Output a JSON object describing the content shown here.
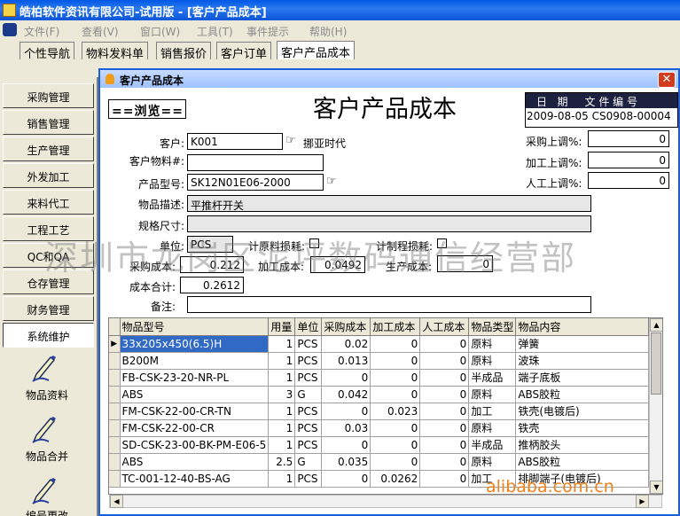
{
  "app": {
    "title": "皓柏软件资讯有限公司-试用版 - [客户产品成本]"
  },
  "menu": [
    {
      "label": "文件(F)"
    },
    {
      "label": "查看(V)"
    },
    {
      "label": "窗口(W)"
    },
    {
      "label": "工具(T)"
    },
    {
      "label": "事件提示"
    },
    {
      "label": "帮助(H)"
    }
  ],
  "tabs": [
    {
      "label": "个性导航"
    },
    {
      "label": "物料发料单"
    },
    {
      "label": "销售报价"
    },
    {
      "label": "客户订单"
    },
    {
      "label": "客户产品成本"
    }
  ],
  "sidebar": {
    "items": [
      {
        "label": "采购管理"
      },
      {
        "label": "销售管理"
      },
      {
        "label": "生产管理"
      },
      {
        "label": "外发加工"
      },
      {
        "label": "来料代工"
      },
      {
        "label": "工程工艺"
      },
      {
        "label": "QC和QA"
      },
      {
        "label": "仓存管理"
      },
      {
        "label": "财务管理"
      },
      {
        "label": "系统维护"
      }
    ],
    "tools": [
      {
        "label": "物品资料",
        "icon": "pen-icon"
      },
      {
        "label": "物品合并",
        "icon": "pen-icon"
      },
      {
        "label": "编号更改",
        "icon": "pen-icon"
      }
    ]
  },
  "dialog": {
    "title": "客户产品成本",
    "mode": "==浏览==",
    "heading": "客户产品成本",
    "info": {
      "header": "日   期     文 件 编 号",
      "date": "2009-08-05",
      "doc_no": "CS0908-00004"
    },
    "adjust": [
      {
        "label": "采购上调%:",
        "value": "0"
      },
      {
        "label": "加工上调%:",
        "value": "0"
      },
      {
        "label": "人工上调%:",
        "value": "0"
      }
    ],
    "form": {
      "customer_label": "客户:",
      "customer_code": "K001",
      "customer_name": "挪亚时代",
      "customer_material_label": "客户物料#:",
      "customer_material": "",
      "product_model_label": "产品型号:",
      "product_model": "SK12N01E06-2000",
      "description_label": "物品描述:",
      "description": "平推杆开关",
      "size_label": "规格尺寸:",
      "size": "",
      "unit_label": "单位:",
      "unit": "PCS",
      "material_loss_label": "计原料损耗:",
      "process_loss_label": "计制程损耗:",
      "purchase_cost_label": "采购成本:",
      "purchase_cost": "0.212",
      "process_cost_label": "加工成本:",
      "process_cost": "0.0492",
      "production_cost_label": "生产成本:",
      "production_cost": "0",
      "total_cost_label": "成本合计:",
      "total_cost": "0.2612",
      "remark_label": "备注:",
      "remark": ""
    },
    "grid": {
      "columns": [
        "物品型号",
        "用量",
        "单位",
        "采购成本",
        "加工成本",
        "人工成本",
        "物品类型",
        "物品内容"
      ],
      "rows": [
        [
          "33x205x450(6.5)H",
          "1",
          "PCS",
          "0.02",
          "0",
          "0",
          "原料",
          "弹簧"
        ],
        [
          "B200M",
          "1",
          "PCS",
          "0.013",
          "0",
          "0",
          "原料",
          "波珠"
        ],
        [
          "FB-CSK-23-20-NR-PL",
          "1",
          "PCS",
          "0",
          "0",
          "0",
          "半成品",
          "端子底板"
        ],
        [
          "ABS",
          "3",
          "G",
          "0.042",
          "0",
          "0",
          "原料",
          "ABS胶粒"
        ],
        [
          "FM-CSK-22-00-CR-TN",
          "1",
          "PCS",
          "0",
          "0.023",
          "0",
          "加工",
          "铁壳(电镀后)"
        ],
        [
          "FM-CSK-22-00-CR",
          "1",
          "PCS",
          "0.03",
          "0",
          "0",
          "原料",
          "铁壳"
        ],
        [
          "SD-CSK-23-00-BK-PM-E06-5",
          "1",
          "PCS",
          "0",
          "0",
          "0",
          "半成品",
          "推柄胶头"
        ],
        [
          "ABS",
          "2.5",
          "G",
          "0.035",
          "0",
          "0",
          "原料",
          "ABS胶粒"
        ],
        [
          "TC-001-12-40-BS-AG",
          "1",
          "PCS",
          "0",
          "0.0262",
          "0",
          "加工",
          "排脚端子(电镀后)"
        ]
      ]
    }
  },
  "watermark": "深圳市龙岗区泥坪数码通信经营部",
  "site_mark": "alibaba.com.cn"
}
